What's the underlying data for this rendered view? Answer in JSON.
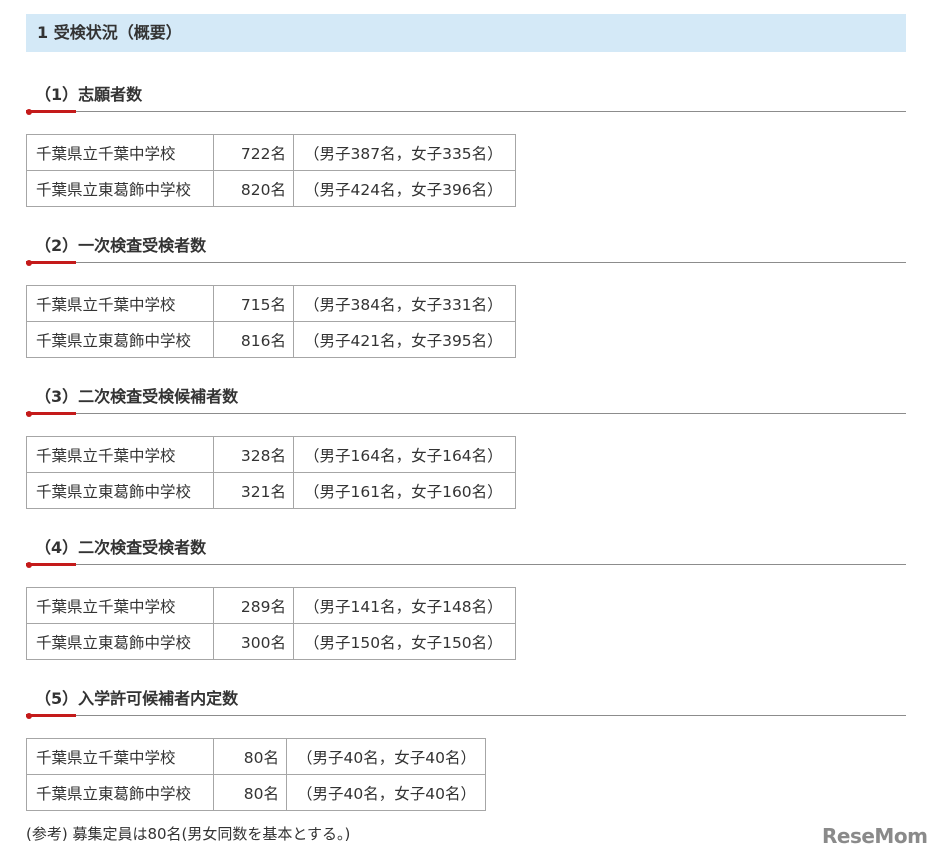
{
  "main_heading": "1 受検状況（概要）",
  "sections": [
    {
      "title": "（1）志願者数",
      "rows": [
        {
          "school": "千葉県立千葉中学校",
          "count": "722名",
          "breakdown": "（男子387名，女子335名）"
        },
        {
          "school": "千葉県立東葛飾中学校",
          "count": "820名",
          "breakdown": "（男子424名，女子396名）"
        }
      ]
    },
    {
      "title": "（2）一次検査受検者数",
      "rows": [
        {
          "school": "千葉県立千葉中学校",
          "count": "715名",
          "breakdown": "（男子384名，女子331名）"
        },
        {
          "school": "千葉県立東葛飾中学校",
          "count": "816名",
          "breakdown": "（男子421名，女子395名）"
        }
      ]
    },
    {
      "title": "（3）二次検査受検候補者数",
      "rows": [
        {
          "school": "千葉県立千葉中学校",
          "count": "328名",
          "breakdown": "（男子164名，女子164名）"
        },
        {
          "school": "千葉県立東葛飾中学校",
          "count": "321名",
          "breakdown": "（男子161名，女子160名）"
        }
      ]
    },
    {
      "title": "（4）二次検査受検者数",
      "rows": [
        {
          "school": "千葉県立千葉中学校",
          "count": "289名",
          "breakdown": "（男子141名，女子148名）"
        },
        {
          "school": "千葉県立東葛飾中学校",
          "count": "300名",
          "breakdown": "（男子150名，女子150名）"
        }
      ]
    },
    {
      "title": "（5）入学許可候補者内定数",
      "rows": [
        {
          "school": "千葉県立千葉中学校",
          "count": "80名",
          "breakdown": "（男子40名，女子40名）"
        },
        {
          "school": "千葉県立東葛飾中学校",
          "count": "80名",
          "breakdown": "（男子40名，女子40名）"
        }
      ]
    }
  ],
  "note": "(参考) 募集定員は80名(男女同数を基本とする。)",
  "logo_text": "ReseMom",
  "colors": {
    "heading_bg": "#d4e9f7",
    "accent": "#c41a1a",
    "border": "#a6a6a6"
  }
}
